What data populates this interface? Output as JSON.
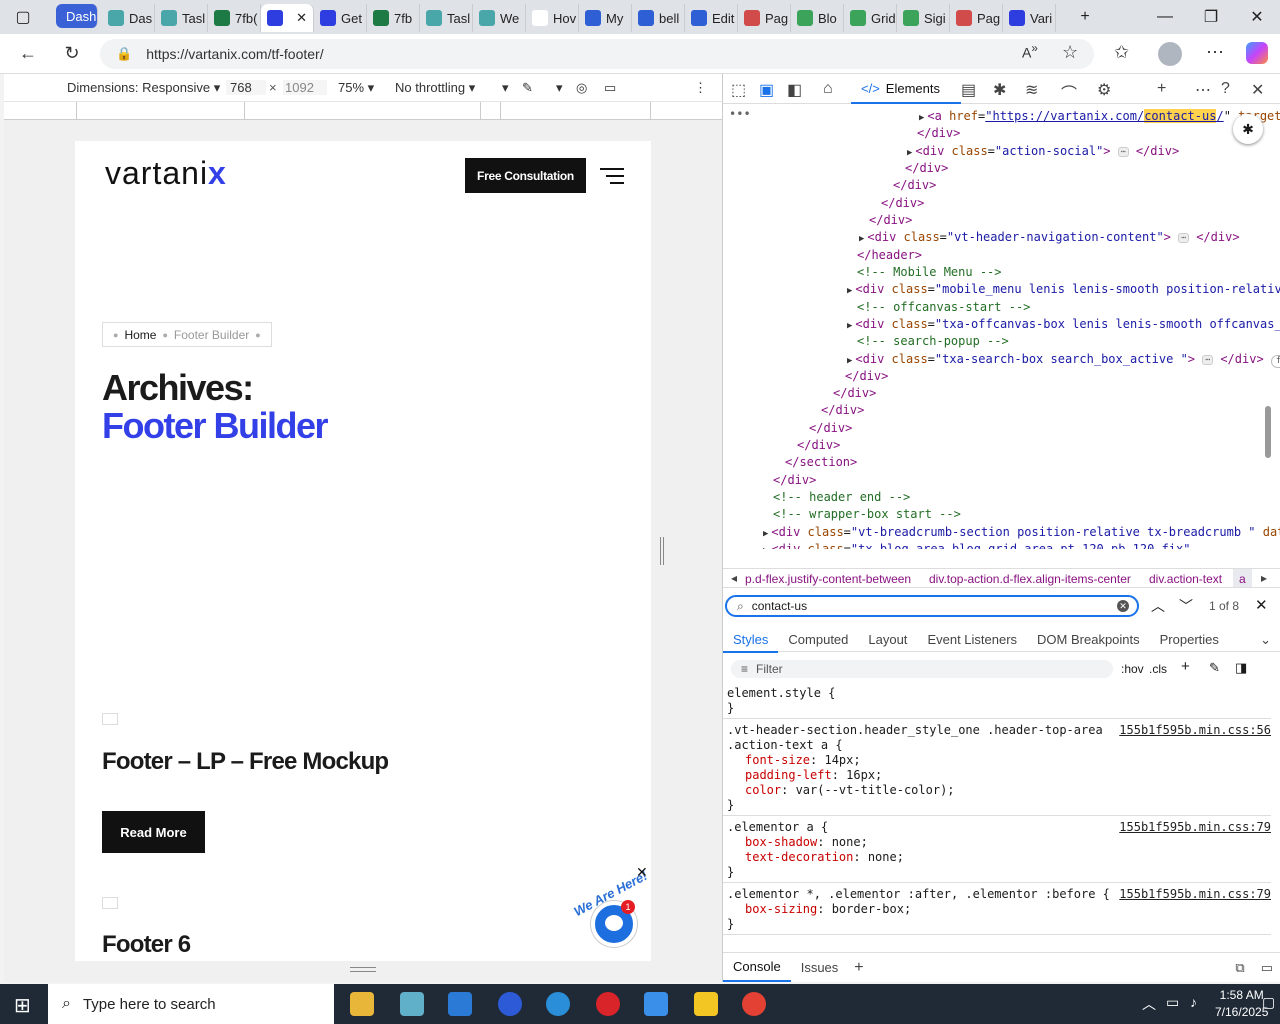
{
  "browser": {
    "tabs": [
      {
        "label": "Dash",
        "favicon": "dash-icon",
        "active": false
      },
      {
        "label": "Das",
        "favicon": "app-icon"
      },
      {
        "label": "Tasl",
        "favicon": "app-icon"
      },
      {
        "label": "7fb(",
        "favicon": "excel-icon"
      },
      {
        "label": "",
        "favicon": "vartanix-icon",
        "active": true
      },
      {
        "label": "Get",
        "favicon": "vartanix-icon"
      },
      {
        "label": "7fb",
        "favicon": "excel-icon"
      },
      {
        "label": "Tasl",
        "favicon": "app-icon"
      },
      {
        "label": "We",
        "favicon": "app-icon"
      },
      {
        "label": "Hov",
        "favicon": "google-icon"
      },
      {
        "label": "My",
        "favicon": "forms-icon"
      },
      {
        "label": "bell",
        "favicon": "forms-icon"
      },
      {
        "label": "Edit",
        "favicon": "forms-icon"
      },
      {
        "label": "Pag",
        "favicon": "page-icon"
      },
      {
        "label": "Blo",
        "favicon": "elementor-icon"
      },
      {
        "label": "Grid",
        "favicon": "elementor-icon"
      },
      {
        "label": "Sigi",
        "favicon": "elementor-icon"
      },
      {
        "label": "Pag",
        "favicon": "page-icon"
      },
      {
        "label": "Vari",
        "favicon": "vartanix-icon"
      }
    ],
    "url": "https://vartanix.com/tf-footer/"
  },
  "devtoolbar": {
    "dimensions_label": "Dimensions: Responsive",
    "width": "768",
    "height_placeholder": "1092",
    "zoom": "75%",
    "throttling": "No throttling"
  },
  "site": {
    "logo_main": "vartani",
    "logo_accent": "x",
    "cta": "Free Consultation",
    "crumb_home": "Home",
    "crumb_current": "Footer Builder",
    "title_line1": "Archives:",
    "title_line2": "Footer Builder",
    "post1_title": "Footer – LP – Free Mockup",
    "read_more": "Read More",
    "post2_title": "Footer 6",
    "chat_text": "We Are Here!",
    "chat_badge": "1"
  },
  "devtools": {
    "elements_tab": "Elements",
    "breadcrumbs": [
      "p.d-flex.justify-content-between",
      "div.top-action.d-flex.align-items-center",
      "div.action-text",
      "a"
    ],
    "search_value": "contact-us",
    "search_count": "1 of 8",
    "style_tabs": [
      "Styles",
      "Computed",
      "Layout",
      "Event Listeners",
      "DOM Breakpoints",
      "Properties"
    ],
    "filter_placeholder": "Filter",
    "hov": ":hov",
    "cls": ".cls",
    "rules": [
      {
        "selector": "element.style {",
        "source": "",
        "props": []
      },
      {
        "selector": ".vt-header-section.header_style_one .header-top-area .action-text a {",
        "source": "155b1f595b.min.css:56",
        "props": [
          {
            "p": "font-size",
            "v": "14px;"
          },
          {
            "p": "padding-left",
            "v": "16px;"
          },
          {
            "p": "color",
            "v": "var(--vt-title-color);"
          }
        ]
      },
      {
        "selector": ".elementor a {",
        "source": "155b1f595b.min.css:79",
        "props": [
          {
            "p": "box-shadow",
            "v": "none;"
          },
          {
            "p": "text-decoration",
            "v": "none;"
          }
        ]
      },
      {
        "selector": ".elementor *, .elementor :after, .elementor :before {",
        "source": "155b1f595b.min.css:79",
        "props": [
          {
            "p": "box-sizing",
            "v": "border-box;"
          }
        ]
      }
    ],
    "console_tab": "Console",
    "issues_tab": "Issues"
  },
  "dom": {
    "l1_href": "https://vartanix.com/",
    "l1_hl": "contact-us",
    "l1_rest": "/\" target=",
    "social_class": "action-social",
    "nav_class": "vt-header-navigation-content",
    "mobile_comment": "<!-- Mobile Menu -->",
    "mobile_class": "mobile_menu lenis lenis-smooth position-relative",
    "offcanvas_comment": "<!-- offcanvas-start -->",
    "offcanvas_class": "txa-offcanvas-box lenis lenis-smooth offcanvas_bo",
    "search_comment": "<!-- search-popup -->",
    "search_class": "txa-search-box search_box_active ",
    "header_end": "<!-- header end -->",
    "wrapper_start": "<!-- wrapper-box start -->",
    "breadcrumb_class": "vt-breadcrumb-section position-relative tx-breadcrumb ",
    "blog_class": "tx-blog-area blog-grid-area pt-120 pb-120 fix"
  },
  "taskbar": {
    "search_placeholder": "Type here to search",
    "time": "1:58 AM",
    "date": "7/16/2025"
  },
  "colors": {
    "accent": "#3340e8",
    "devtools_blue": "#1a73e8"
  }
}
